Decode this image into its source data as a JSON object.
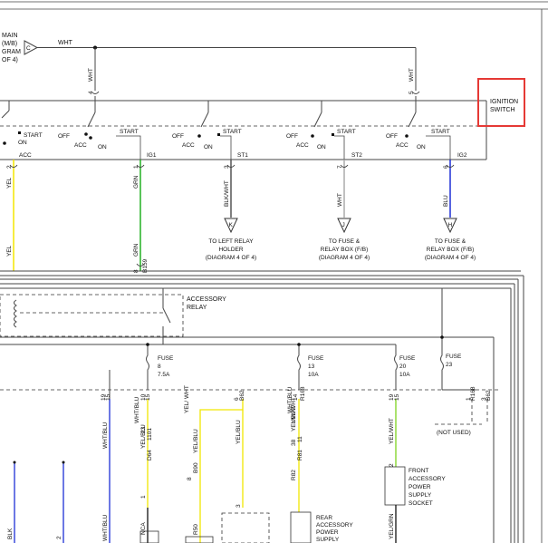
{
  "ignition_switch": {
    "label_line1": "IGNITION",
    "label_line2": "SWITCH",
    "highlight_color": "#e53935"
  },
  "top_ref": {
    "lines": [
      "MAIN",
      "(M/B)",
      "GRAM",
      "OF 4)"
    ],
    "connector": "C",
    "wire": "WHT"
  },
  "feed_wires": [
    {
      "pin": "4",
      "color": "WHT"
    },
    {
      "pin": "5",
      "color": "WHT"
    }
  ],
  "switch_positions": {
    "off": "OFF",
    "acc": "ACC",
    "on": "ON",
    "start": "START"
  },
  "terminals": [
    {
      "name": "ACC",
      "pin": "2",
      "color": "YEL",
      "hex": "#f2e600"
    },
    {
      "name": "IG1",
      "pin": "1",
      "color": "GRN",
      "hex": "#22b022"
    },
    {
      "name": "ST1",
      "pin": "3",
      "color": "BLK/WHT",
      "hex": "#555555"
    },
    {
      "name": "ST2",
      "pin": "7",
      "color": "WHT",
      "hex": "#aaaaaa"
    },
    {
      "name": "IG2",
      "pin": "6",
      "color": "BLU",
      "hex": "#1d2fd6"
    }
  ],
  "connectors": [
    {
      "letter": "K",
      "lines": [
        "TO LEFT RELAY",
        "HOLDER",
        "(DIAGRAM 4 OF 4)"
      ]
    },
    {
      "letter": "J",
      "lines": [
        "TO FUSE &",
        "RELAY BOX (F/B)",
        "(DIAGRAM 4 OF 4)"
      ]
    },
    {
      "letter": "H",
      "lines": [
        "TO FUSE &",
        "RELAY BOX (F/B)",
        "(DIAGRAM 4 OF 4)"
      ]
    }
  ],
  "lower_wires": {
    "yel": "YEL",
    "grn": "GRN",
    "grn_pin": "8",
    "grn_conn": "B159"
  },
  "accessory_relay": {
    "line1": "ACCESSORY",
    "line2": "RELAY"
  },
  "fuses": [
    {
      "label": "FUSE",
      "num": "8",
      "amps": "7.5A"
    },
    {
      "label": "FUSE",
      "num": "13",
      "amps": "10A"
    },
    {
      "label": "FUSE",
      "num": "20",
      "amps": "10A"
    },
    {
      "label": "FUSE",
      "num": "23",
      "amps": ""
    }
  ],
  "box_pins": [
    "19",
    "15",
    "10",
    "15",
    "6",
    "B62",
    "14",
    "R168",
    "19",
    "15",
    "1",
    "R168",
    "3",
    "B62",
    "B62"
  ],
  "wire_labels": [
    "WHT/BLU",
    "YEL/BLU",
    "23",
    "1101",
    "D64",
    "1",
    "NCA",
    "YEL/BLU",
    "8",
    "B90",
    "R50",
    "YEL/BLU",
    "3",
    "YEL/WHT",
    "38",
    "YEL/WHT",
    "11",
    "R81",
    "R82",
    "YEL/WHT",
    "2",
    "YEL/GRN",
    "2",
    "BLK",
    "WHT/BLU",
    "WHT/BLU",
    "WHT/BLU",
    "YEL/",
    "WHT",
    "YEL/"
  ],
  "not_used": "(NOT USED)",
  "rear_socket": [
    "REAR",
    "ACCESSORY",
    "POWER",
    "SUPPLY"
  ],
  "front_socket": [
    "FRONT",
    "ACCESSORY",
    "POWER",
    "SUPPLY",
    "SOCKET"
  ]
}
